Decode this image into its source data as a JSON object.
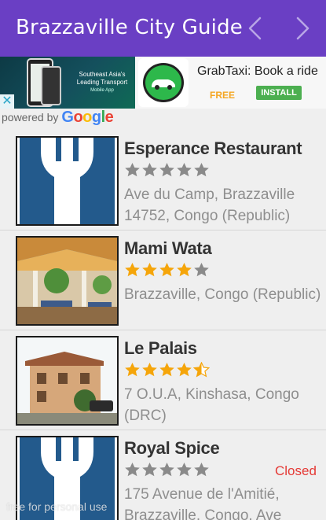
{
  "app_bar": {
    "title": "Brazzaville City Guide",
    "prev_icon": "chevron-left-icon",
    "next_icon": "chevron-right-icon",
    "color": "#6a3fc4"
  },
  "ad": {
    "image_text": "Southeast Asia's Leading Transport",
    "image_subtext": "Mobile App",
    "headline": "GrabTaxi: Book a ride",
    "price": "FREE",
    "install_label": "INSTALL",
    "close_icon": "close-icon"
  },
  "attribution": {
    "prefix": "powered by",
    "google": [
      "G",
      "o",
      "o",
      "g",
      "l",
      "e"
    ],
    "google_colors": [
      "#4285f4",
      "#ea4335",
      "#fbbc05",
      "#4285f4",
      "#34a853",
      "#ea4335"
    ]
  },
  "places": [
    {
      "name": "Esperance Restaurant",
      "rating": 0,
      "address": "Ave du Camp, Brazzaville 14752, Congo (Republic)",
      "status": "",
      "thumb_icon": "fork-icon"
    },
    {
      "name": "Mami Wata",
      "rating": 4,
      "address": "Brazzaville, Congo (Republic)",
      "status": "",
      "thumb_icon": "restaurant-photo"
    },
    {
      "name": "Le Palais",
      "rating": 4.5,
      "address": "7 O.U.A, Kinshasa, Congo (DRC)",
      "status": "",
      "thumb_icon": "building-photo"
    },
    {
      "name": "Royal Spice",
      "rating": 0,
      "address": "175 Avenue de l'Amitié, Brazzaville, Congo, Ave",
      "status": "Closed",
      "thumb_icon": "fork-icon"
    }
  ],
  "colors": {
    "star_filled": "#f5a50a",
    "star_empty": "#8a8a8a",
    "closed": "#e53935"
  },
  "watermark": "free for personal use"
}
